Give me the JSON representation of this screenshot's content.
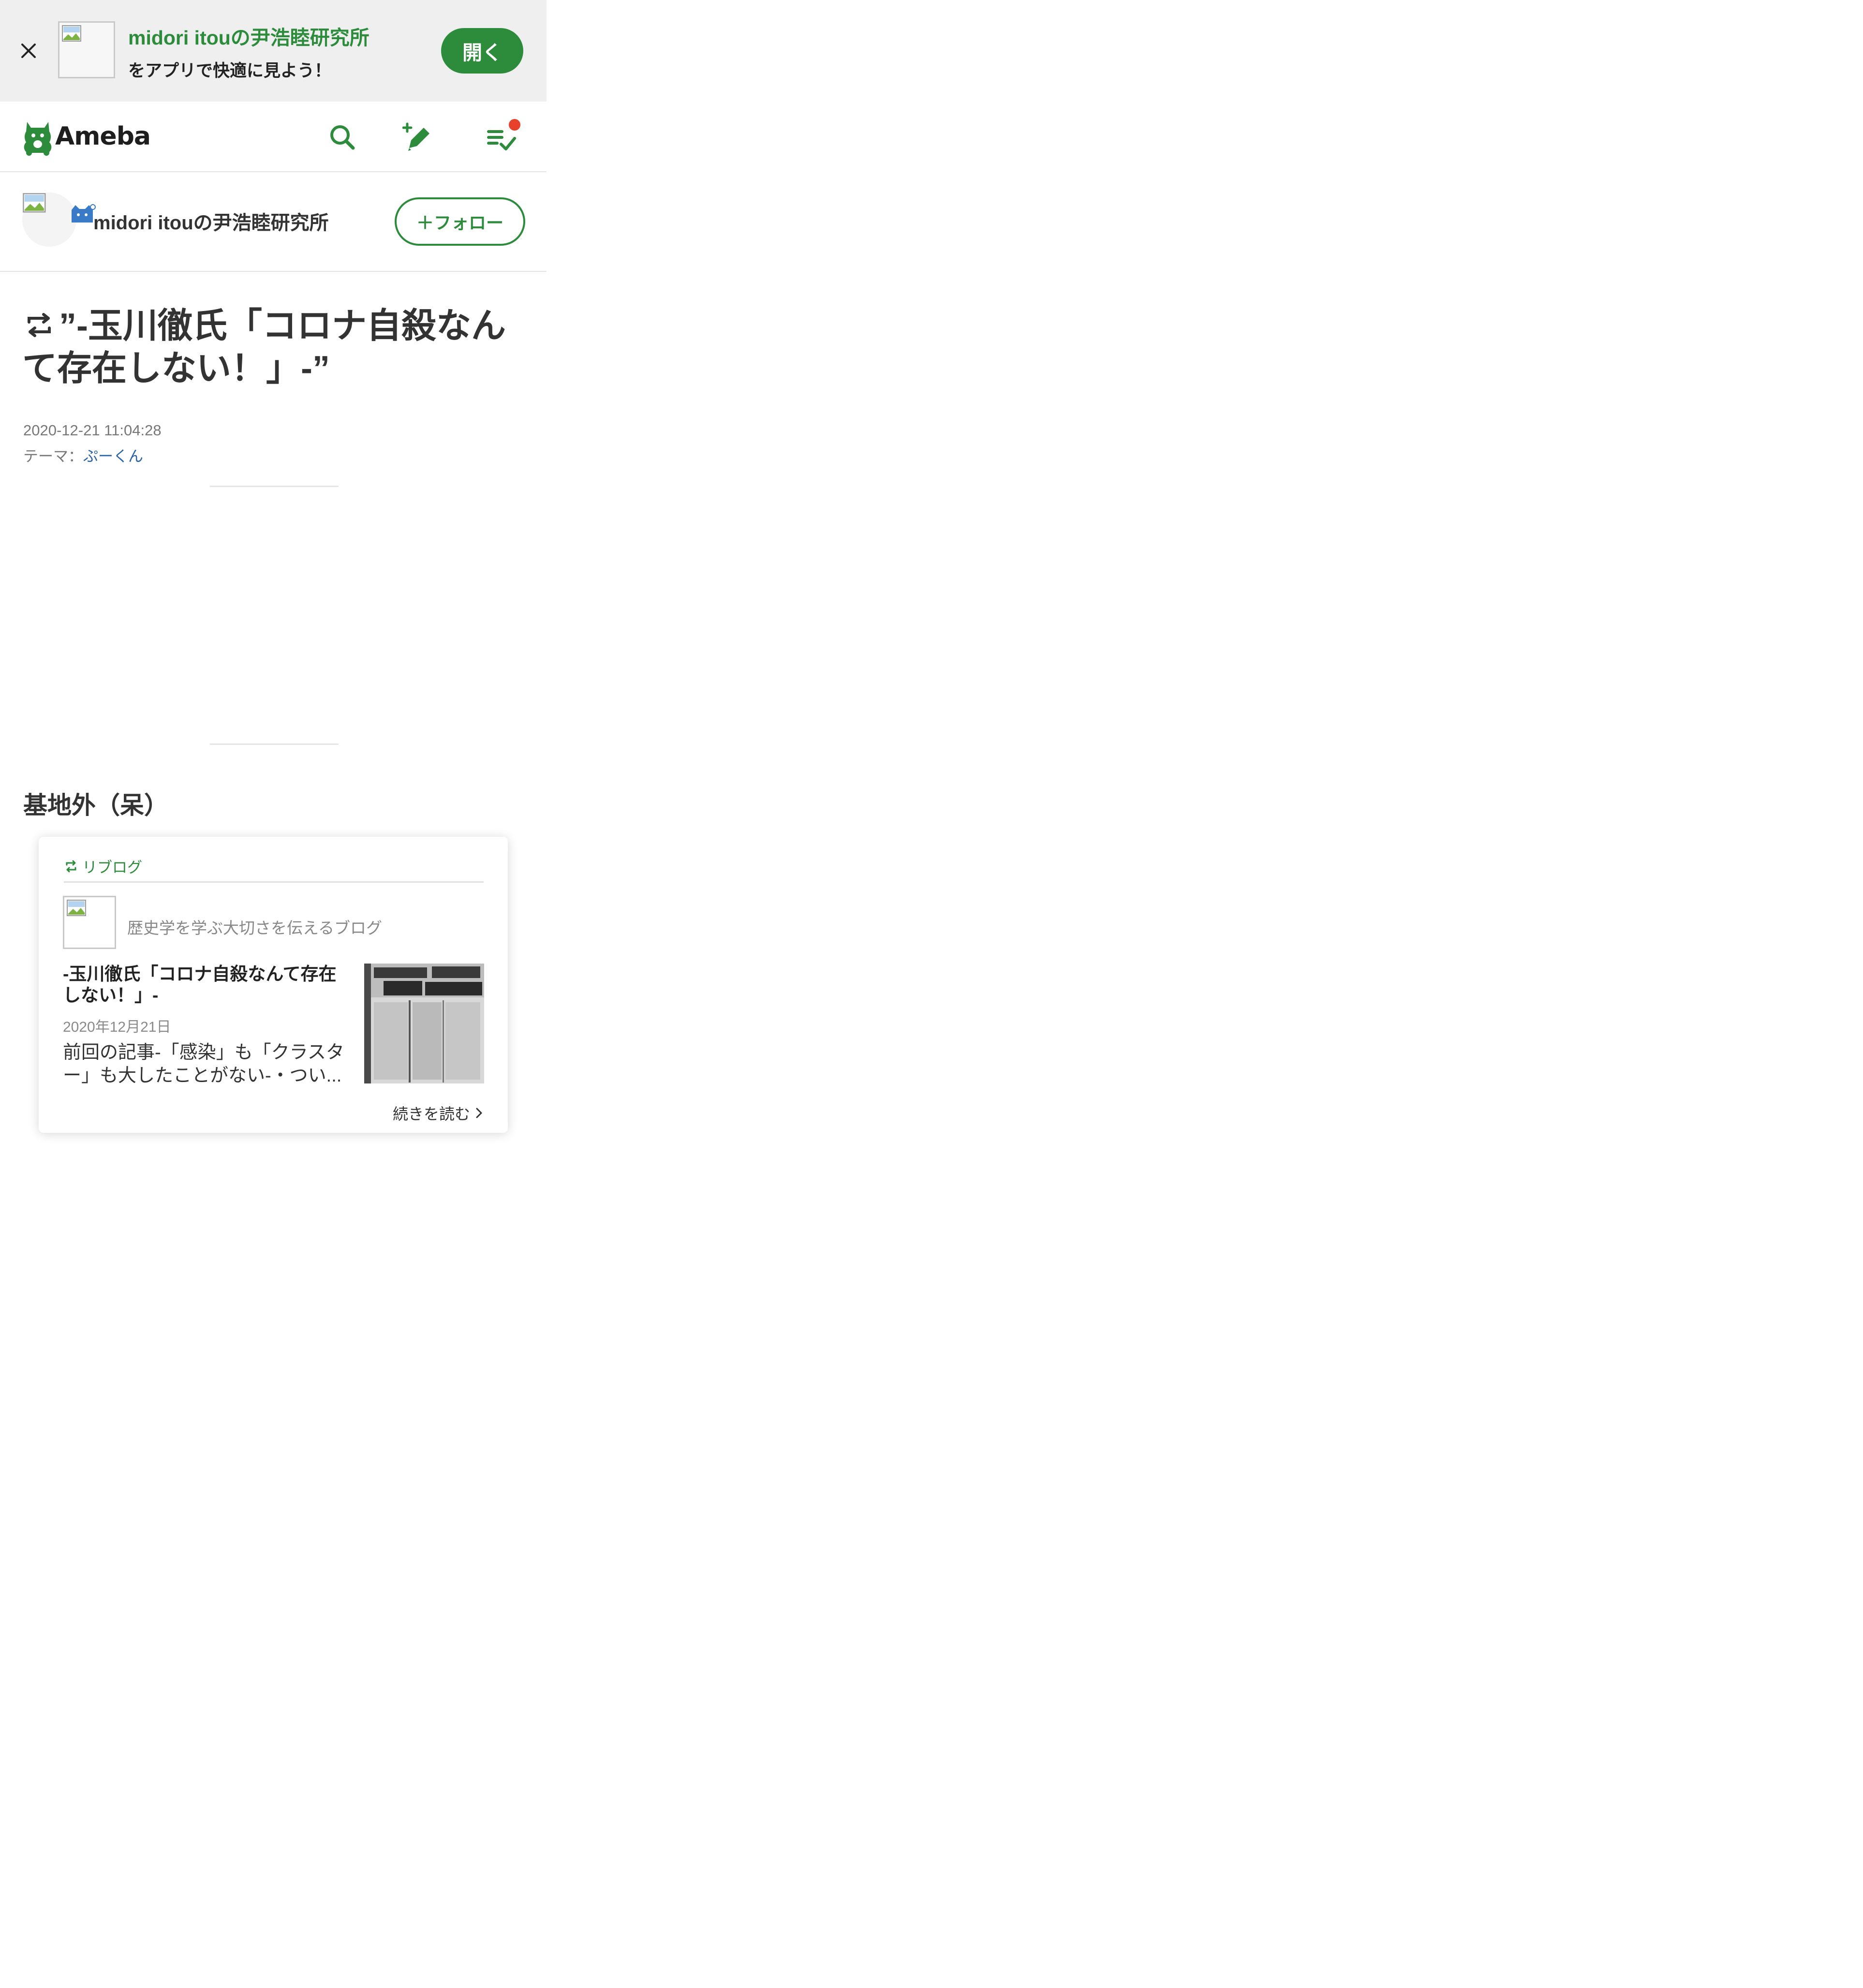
{
  "app_banner": {
    "title": "midori itouの尹浩睦研究所",
    "subtitle": "をアプリで快適に見よう！",
    "open_label": "開く"
  },
  "header": {
    "logo_text": "Ameba",
    "icons": [
      "search-icon",
      "write-icon",
      "checklist-icon"
    ],
    "notification": true
  },
  "blog": {
    "name": "midori itouの尹浩睦研究所",
    "follow_label": "＋フォロー"
  },
  "article": {
    "title": "”-玉川徹氏「コロナ自殺なんて存在しない！」-”",
    "date": "2020-12-21 11:04:28",
    "theme_prefix": "テーマ：",
    "theme": "ぷーくん",
    "body_text": "基地外（呆）"
  },
  "reblog_card": {
    "label": "リブログ",
    "blog_name": "歴史学を学ぶ大切さを伝えるブログ",
    "title": "-玉川徹氏「コロナ自殺なんて存在しない！」-",
    "date": "2020年12月21日",
    "excerpt": "前回の記事-「感染」も「クラスター」も大したことがない-・つい...",
    "read_more": "続きを読む"
  },
  "colors": {
    "brand_green": "#2d8c3c",
    "notify_red": "#e8412b",
    "link_blue": "#2b64a6",
    "banner_bg": "#efefef"
  }
}
